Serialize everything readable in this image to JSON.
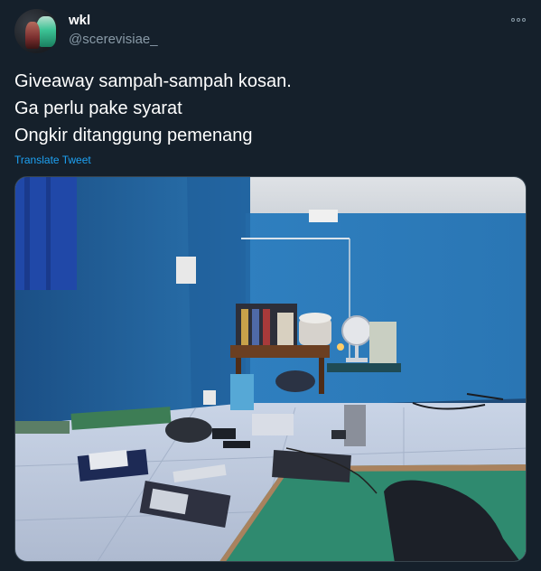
{
  "user": {
    "display_name": "wkl",
    "handle": "@scerevisiae_",
    "avatar_icon": "profile-photo"
  },
  "tweet": {
    "lines": [
      "Giveaway sampah-sampah kosan.",
      "Ga perlu pake syarat",
      "Ongkir ditanggung pemenang"
    ],
    "translate_label": "Translate Tweet"
  },
  "menu": {
    "icon": "more-horizontal-icon"
  },
  "media": {
    "description_icon": "room-photo"
  },
  "colors": {
    "background": "#15202b",
    "text": "#ffffff",
    "secondary_text": "#8899a6",
    "link": "#1da1f2",
    "border": "#38444d"
  }
}
